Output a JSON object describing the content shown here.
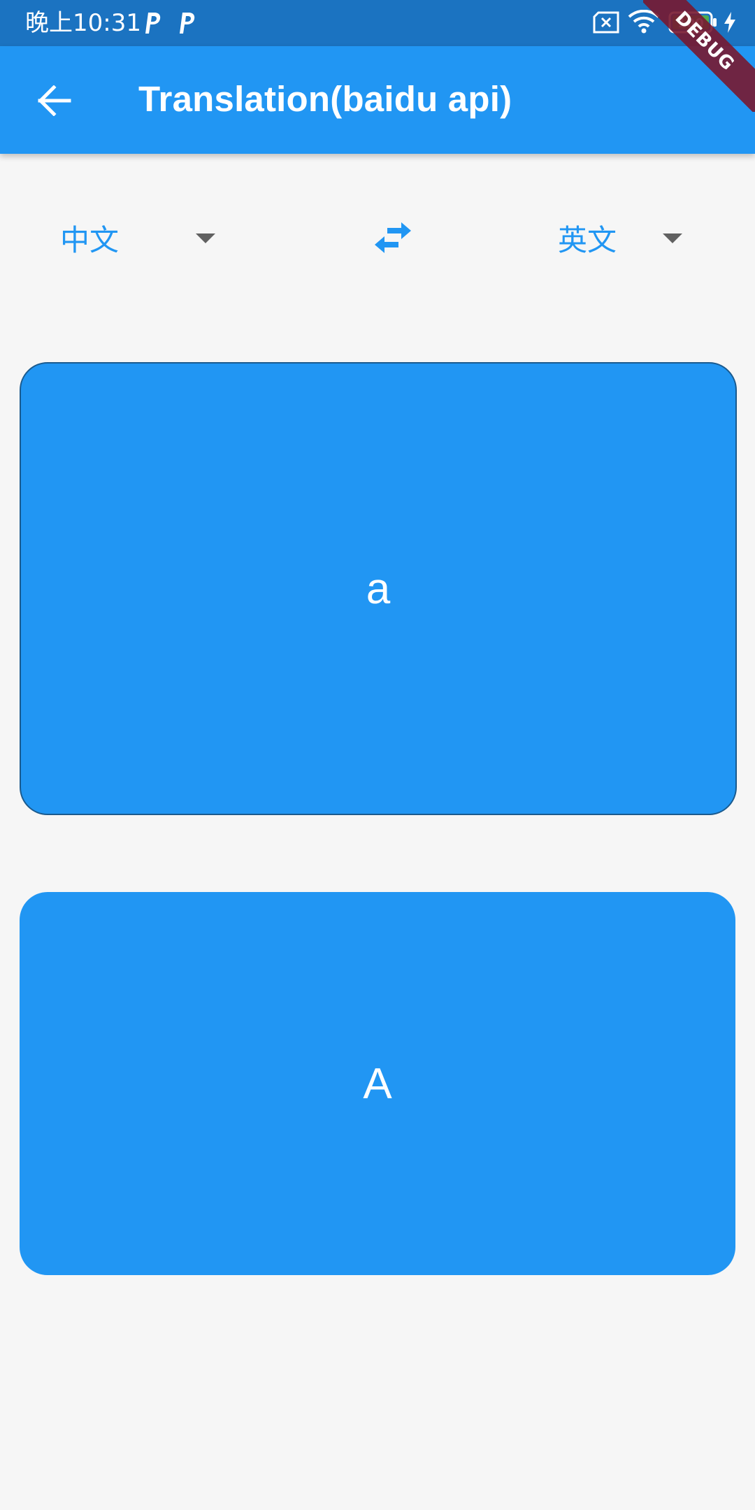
{
  "status_bar": {
    "time": "晚上10:31",
    "battery": "100",
    "icons": [
      "p-notification-icon",
      "p-notification-icon",
      "sim-off-icon",
      "wifi-icon",
      "battery-icon",
      "charging-icon"
    ],
    "background_color": "#1b73c1"
  },
  "debug_banner": {
    "label": "DEBUG"
  },
  "app_bar": {
    "title": "Translation(baidu api)",
    "back_icon": "arrow-back-icon",
    "background_color": "#2196f3"
  },
  "language_selector": {
    "source_language": "中文",
    "target_language": "英文",
    "swap_icon": "swap-horiz-icon",
    "dropdown_icon": "arrow-drop-down-icon",
    "accent_color": "#2196f3"
  },
  "input_card": {
    "text": "a"
  },
  "output_card": {
    "text": "A"
  },
  "colors": {
    "page_background": "#f6f6f6",
    "card_background": "#2196f3",
    "card_text": "#ffffff"
  }
}
